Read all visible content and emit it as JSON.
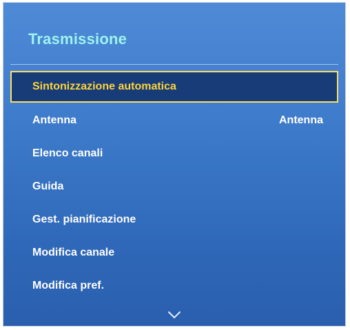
{
  "menu": {
    "title": "Trasmissione",
    "items": [
      {
        "label": "Sintonizzazione automatica",
        "value": "",
        "selected": true
      },
      {
        "label": "Antenna",
        "value": "Antenna",
        "selected": false
      },
      {
        "label": "Elenco canali",
        "value": "",
        "selected": false
      },
      {
        "label": "Guida",
        "value": "",
        "selected": false
      },
      {
        "label": "Gest. pianificazione",
        "value": "",
        "selected": false
      },
      {
        "label": "Modifica canale",
        "value": "",
        "selected": false
      },
      {
        "label": "Modifica pref.",
        "value": "",
        "selected": false
      }
    ],
    "scroll_icon": "chevron-down-icon"
  },
  "colors": {
    "title": "#9ff3ee",
    "selected_text": "#ffd43a",
    "selected_border": "#ffe066",
    "selected_background": "#173c78",
    "panel": "#3f7ccc"
  }
}
